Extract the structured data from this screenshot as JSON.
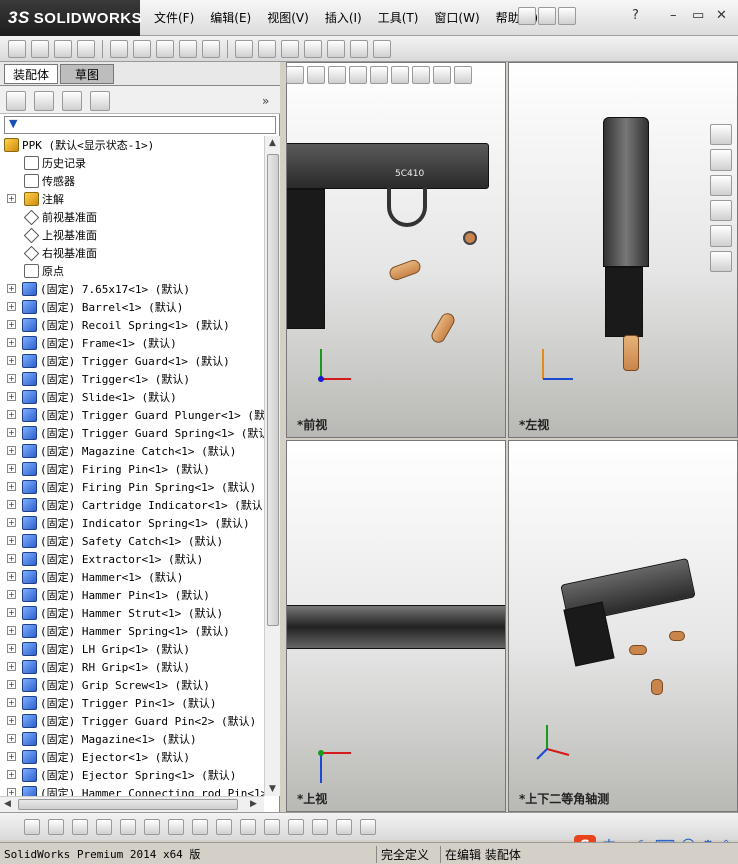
{
  "app": {
    "brand": "SOLIDWORKS",
    "brand_prefix": "3S"
  },
  "menu": [
    "文件(F)",
    "编辑(E)",
    "视图(V)",
    "插入(I)",
    "工具(T)",
    "窗口(W)",
    "帮助(H)"
  ],
  "window_controls": {
    "minimize": "–",
    "restore": "▭",
    "close": "✕",
    "help": "?"
  },
  "panel": {
    "tabs": [
      "装配体",
      "草图"
    ],
    "root": "PPK  (默认<显示状态-1>)",
    "folders": [
      "历史记录",
      "传感器",
      "注解",
      "前视基准面",
      "上视基准面",
      "右视基准面",
      "原点"
    ],
    "parts": [
      "(固定) 7.65x17<1> (默认)",
      "(固定) Barrel<1> (默认)",
      "(固定) Recoil Spring<1> (默认)",
      "(固定) Frame<1> (默认)",
      "(固定) Trigger Guard<1> (默认)",
      "(固定) Trigger<1> (默认)",
      "(固定) Slide<1> (默认)",
      "(固定) Trigger Guard Plunger<1> (默认",
      "(固定) Trigger Guard Spring<1> (默认)",
      "(固定) Magazine Catch<1> (默认)",
      "(固定) Firing Pin<1> (默认)",
      "(固定) Firing Pin Spring<1> (默认)",
      "(固定) Cartridge Indicator<1> (默认)",
      "(固定) Indicator Spring<1> (默认)",
      "(固定) Safety Catch<1> (默认)",
      "(固定) Extractor<1> (默认)",
      "(固定) Hammer<1> (默认)",
      "(固定) Hammer Pin<1> (默认)",
      "(固定) Hammer Strut<1> (默认)",
      "(固定) Hammer Spring<1> (默认)",
      "(固定) LH Grip<1> (默认)",
      "(固定) RH Grip<1> (默认)",
      "(固定) Grip Screw<1> (默认)",
      "(固定) Trigger  Pin<1> (默认)",
      "(固定) Trigger Guard Pin<2> (默认)",
      "(固定) Magazine<1> (默认)",
      "(固定) Ejector<1> (默认)",
      "(固定) Ejector Spring<1> (默认)",
      "(固定) Hammer Connecting rod Pin<1>"
    ]
  },
  "viewports": {
    "front": "*前视",
    "left": "*左视",
    "top": "*上视",
    "iso": "*上下二等角轴测",
    "serial": "5C410"
  },
  "status": {
    "product": "SolidWorks Premium 2014 x64 版",
    "def": "完全定义",
    "mode": "在编辑 装配体"
  },
  "ime": {
    "label": "中",
    "logo": "S"
  },
  "colors": {
    "accent": "#1a58c8"
  }
}
